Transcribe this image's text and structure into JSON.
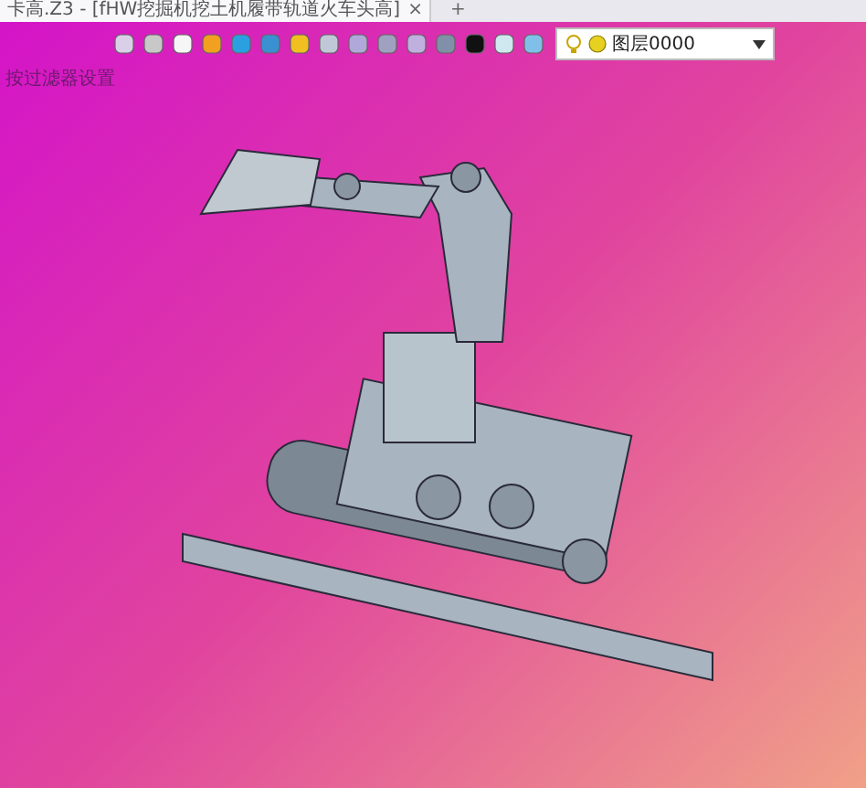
{
  "document_tab": {
    "title": "卡高.Z3 - [fHW挖掘机挖土机履带轨道火车头高]",
    "close": "×"
  },
  "new_tab": "+",
  "layer_dropdown": {
    "value": "图层0000"
  },
  "filter_label": "按过滤器设置"
}
